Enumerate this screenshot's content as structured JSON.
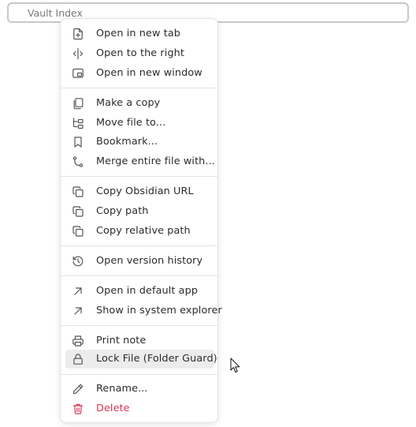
{
  "header": {
    "title_text": "Vault Index"
  },
  "context_menu": {
    "items": [
      {
        "label": "Open in new tab",
        "icon": "file-plus-icon"
      },
      {
        "label": "Open to the right",
        "icon": "split-view-icon"
      },
      {
        "label": "Open in new window",
        "icon": "new-window-icon"
      },
      {
        "label": "Make a copy",
        "icon": "copy-file-icon"
      },
      {
        "label": "Move file to...",
        "icon": "folder-tree-icon"
      },
      {
        "label": "Bookmark...",
        "icon": "bookmark-icon"
      },
      {
        "label": "Merge entire file with...",
        "icon": "git-merge-icon"
      },
      {
        "label": "Copy Obsidian URL",
        "icon": "copy-icon"
      },
      {
        "label": "Copy path",
        "icon": "copy-icon"
      },
      {
        "label": "Copy relative path",
        "icon": "copy-icon"
      },
      {
        "label": "Open version history",
        "icon": "history-icon"
      },
      {
        "label": "Open in default app",
        "icon": "arrow-up-right-icon"
      },
      {
        "label": "Show in system explorer",
        "icon": "arrow-up-right-icon"
      },
      {
        "label": "Print note",
        "icon": "printer-icon"
      },
      {
        "label": "Lock File (Folder Guard)",
        "icon": "lock-icon",
        "highlighted": true
      },
      {
        "label": "Rename...",
        "icon": "pencil-icon"
      },
      {
        "label": "Delete",
        "icon": "trash-icon",
        "danger": true
      }
    ]
  },
  "colors": {
    "menu_text": "#2b2b2b",
    "danger": "#e0334d",
    "highlight_bg": "#ececec",
    "separator": "#e3e3e3",
    "icon": "#555555"
  }
}
